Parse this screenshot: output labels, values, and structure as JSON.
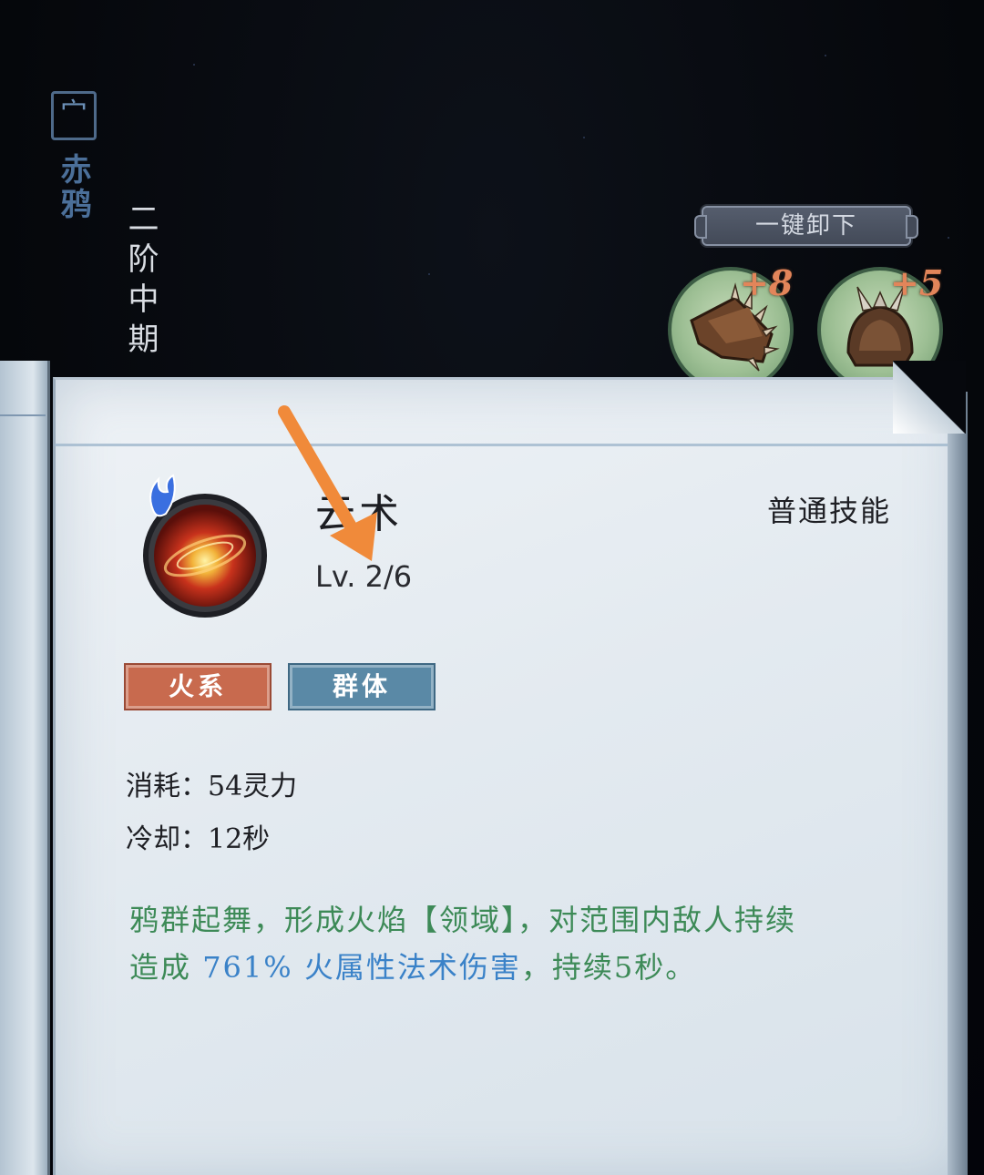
{
  "character": {
    "seal_glyph": "宀",
    "name": "赤鸦",
    "stage": "二阶中期"
  },
  "toolbar": {
    "unequip_all_label": "一键卸下"
  },
  "equipment": [
    {
      "bonus": "+8",
      "icon": "spiked-gauntlet-icon"
    },
    {
      "bonus": "+5",
      "icon": "horned-helmet-icon"
    }
  ],
  "skill": {
    "name_visible": "云术",
    "level": "Lv. 2/6",
    "category": "普通技能",
    "tags": [
      "火系",
      "群体"
    ],
    "cost_label": "消耗：",
    "cost_value": "54灵力",
    "cooldown_label": "冷却：",
    "cooldown_value": "12秒",
    "description": {
      "line1": "鸦群起舞，形成火焰【领域】，对范围内敌人持续",
      "line2_prefix": "造成 ",
      "damage": "761%",
      "damage_type": " 火属性法术伤害",
      "line2_suffix": "，持续5秒。"
    }
  },
  "colors": {
    "fire_tag": "#c86a4e",
    "group_tag": "#5a89a6",
    "description_text": "#3d8a57",
    "highlight_text": "#3a82c8",
    "arrow": "#f08a3a"
  }
}
